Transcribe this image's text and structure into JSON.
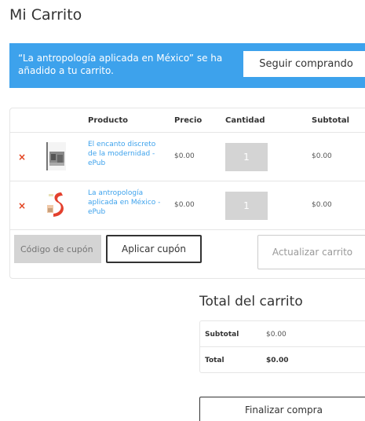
{
  "page": {
    "title": "Mi Carrito"
  },
  "notice": {
    "message": "“La antropología aplicada en México” se ha añadido a tu carrito.",
    "continue_label": "Seguir comprando",
    "background": "#3da2ec"
  },
  "cart": {
    "columns": {
      "product": "Producto",
      "price": "Precio",
      "quantity": "Cantidad",
      "subtotal": "Subtotal"
    },
    "items": [
      {
        "remove_icon": "×",
        "name": "El encanto discreto de la modernidad - ePub",
        "price": "$0.00",
        "quantity": "1",
        "subtotal": "$0.00"
      },
      {
        "remove_icon": "×",
        "name": "La antropología aplicada en México - ePub",
        "price": "$0.00",
        "quantity": "1",
        "subtotal": "$0.00"
      }
    ],
    "coupon_placeholder": "Código de cupón",
    "apply_coupon_label": "Aplicar cupón",
    "update_cart_label": "Actualizar carrito"
  },
  "totals": {
    "title": "Total del carrito",
    "subtotal_label": "Subtotal",
    "subtotal_value": "$0.00",
    "total_label": "Total",
    "total_value": "$0.00"
  },
  "checkout": {
    "label": "Finalizar compra"
  },
  "colors": {
    "accent": "#3da2ec",
    "remove": "#e2401c",
    "link": "#3da2ec"
  }
}
